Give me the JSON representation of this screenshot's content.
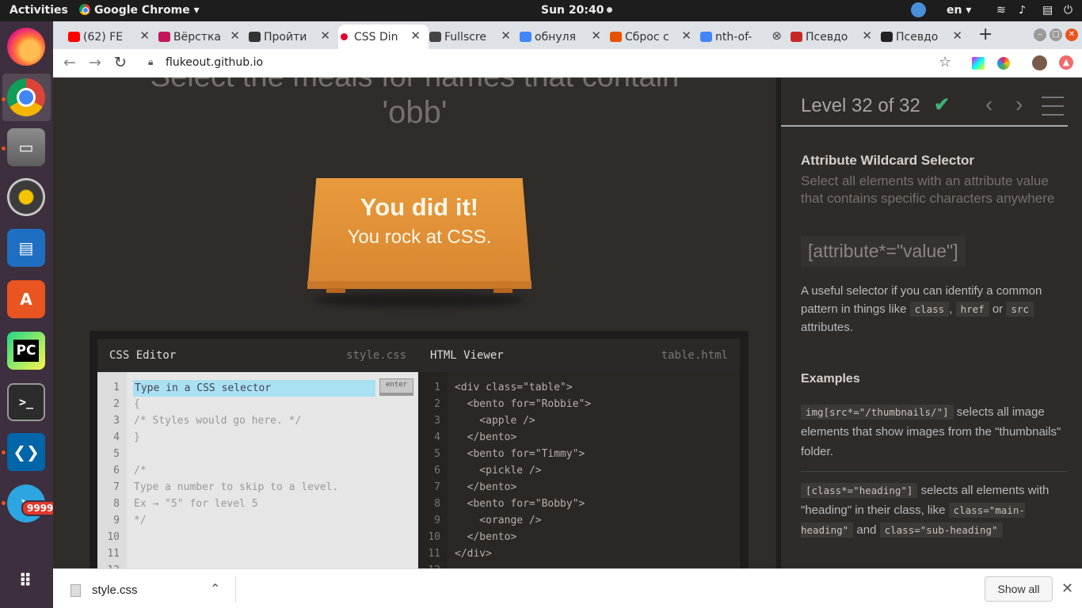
{
  "system": {
    "activities": "Activities",
    "app_menu": "Google Chrome ▾",
    "clock": "Sun 20:40",
    "lang": "en ▾"
  },
  "dock": {
    "pycharm": "PC",
    "terminal": ">_",
    "telegram_badge": "9999"
  },
  "tabs": [
    {
      "title": "(62) FE",
      "color": "#ff0000"
    },
    {
      "title": "Вёрстка",
      "color": "#c2185b"
    },
    {
      "title": "Пройти",
      "color": "#333333"
    },
    {
      "title": "CSS Din",
      "color": "#e4002b"
    },
    {
      "title": "Fullscre",
      "color": "#444444"
    },
    {
      "title": "обнуля",
      "color": "#4285f4"
    },
    {
      "title": "Сброс с",
      "color": "#e65100"
    },
    {
      "title": "nth-of-",
      "color": "#4285f4"
    },
    {
      "title": "Псевдо",
      "color": "#c62828"
    },
    {
      "title": "Псевдо",
      "color": "#222222"
    }
  ],
  "browser": {
    "url": "flukeout.github.io"
  },
  "game": {
    "order_top": "Select the meals for names that contain",
    "order_bottom": "'obb'",
    "win_title": "You did it!",
    "win_subtitle": "You rock at CSS."
  },
  "editor": {
    "css_label": "CSS Editor",
    "css_file": "style.css",
    "html_label": "HTML Viewer",
    "html_file": "table.html",
    "input_placeholder": "Type in a CSS selector",
    "enter_label": "enter",
    "line_numbers": [
      "1",
      "2",
      "3",
      "4",
      "5",
      "6",
      "7",
      "8",
      "9",
      "10",
      "11",
      "12"
    ],
    "css_lines": [
      "",
      "{",
      "/* Styles would go here. */",
      "}",
      "",
      "/*",
      "Type a number to skip to a level.",
      "Ex → \"5\" for level 5",
      "*/",
      "",
      ""
    ],
    "html_lines": [
      "<div class=\"table\">",
      "  <bento for=\"Robbie\">",
      "    <apple />",
      "  </bento>",
      "  <bento for=\"Timmy\">",
      "    <pickle />",
      "  </bento>",
      "  <bento for=\"Bobby\">",
      "    <orange />",
      "  </bento>",
      "</div>"
    ]
  },
  "sidebar": {
    "level": "Level 32 of 32",
    "progress_fraction": 1.0,
    "selector_name": "Attribute Wildcard Selector",
    "selector_title": "Select all elements with an attribute value that contains specific characters anywhere",
    "syntax": "[attribute*=\"value\"]",
    "hint_before": "A useful selector if you can identify a common pattern in things like ",
    "hint_code1": "class",
    "hint_comma": ", ",
    "hint_code2": "href",
    "hint_or": " or ",
    "hint_code3": "src",
    "hint_after": " attributes.",
    "examples_heading": "Examples",
    "ex1_code": "img[src*=\"/thumbnails/\"]",
    "ex1_text": " selects all image elements that show images from the \"thumbnails\" folder.",
    "ex2_code": "[class*=\"heading\"]",
    "ex2_text": " selects all elements with \"heading\" in their class, like ",
    "ex2_code2": "class=\"main-heading\"",
    "ex2_and": " and ",
    "ex2_code3": "class=\"sub-heading\""
  },
  "downloads": {
    "file": "style.css",
    "show_all": "Show all"
  },
  "colors": {
    "accent_orange": "#e95420",
    "table_orange": "#e89a3c",
    "check_green": "#3cb371",
    "input_highlight": "#a9e1f3"
  }
}
